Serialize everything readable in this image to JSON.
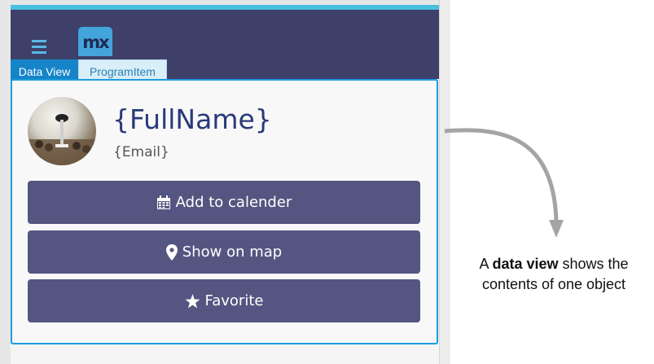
{
  "header": {
    "menu_icon": "hamburger-menu-icon",
    "logo_text": "mx"
  },
  "tags": {
    "data_view": "Data View",
    "entity": "ProgramItem"
  },
  "profile": {
    "avatar_icon": "microphone-audience-photo",
    "full_name": "{FullName}",
    "email": "{Email}"
  },
  "buttons": [
    {
      "label": "Add to calender",
      "icon": "calendar-icon"
    },
    {
      "label": "Show on map",
      "icon": "map-marker-icon"
    },
    {
      "label": "Favorite",
      "icon": "star-icon"
    }
  ],
  "annotation": {
    "pre": "A ",
    "bold": "data view",
    "post": " shows the",
    "line2": "contents of one object"
  },
  "colors": {
    "header": "#3e4069",
    "accent": "#4ac0dc",
    "button": "#555581",
    "dataview_border": "#1e9be0",
    "tag_data_view": "#1584c9",
    "tag_entity": "#d8eef8"
  }
}
